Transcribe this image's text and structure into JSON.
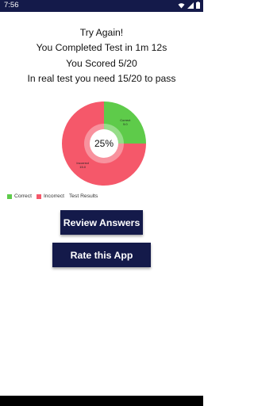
{
  "status_bar": {
    "time": "7:56",
    "icons": [
      "wifi-icon",
      "signal-icon",
      "battery-icon"
    ]
  },
  "result": {
    "line1": "Try Again!",
    "line2": "You Completed Test in 1m 12s",
    "line3": "You Scored 5/20",
    "line4": "In real test you need 15/20 to pass"
  },
  "chart_data": {
    "type": "pie",
    "style": "donut",
    "center_label": "25%",
    "slices": [
      {
        "name": "Correct",
        "value": 5,
        "color": "#5ecb4a"
      },
      {
        "name": "Incorrect",
        "value": 15,
        "color": "#f5586a"
      }
    ],
    "legend": [
      "Correct",
      "Incorrect"
    ],
    "legend_title": "Test Results",
    "legend_placement": "bottom-left"
  },
  "buttons": {
    "review": "Review Answers",
    "rate": "Rate this App"
  },
  "colors": {
    "primary": "#141a4a",
    "correct": "#5ecb4a",
    "incorrect": "#f5586a"
  }
}
